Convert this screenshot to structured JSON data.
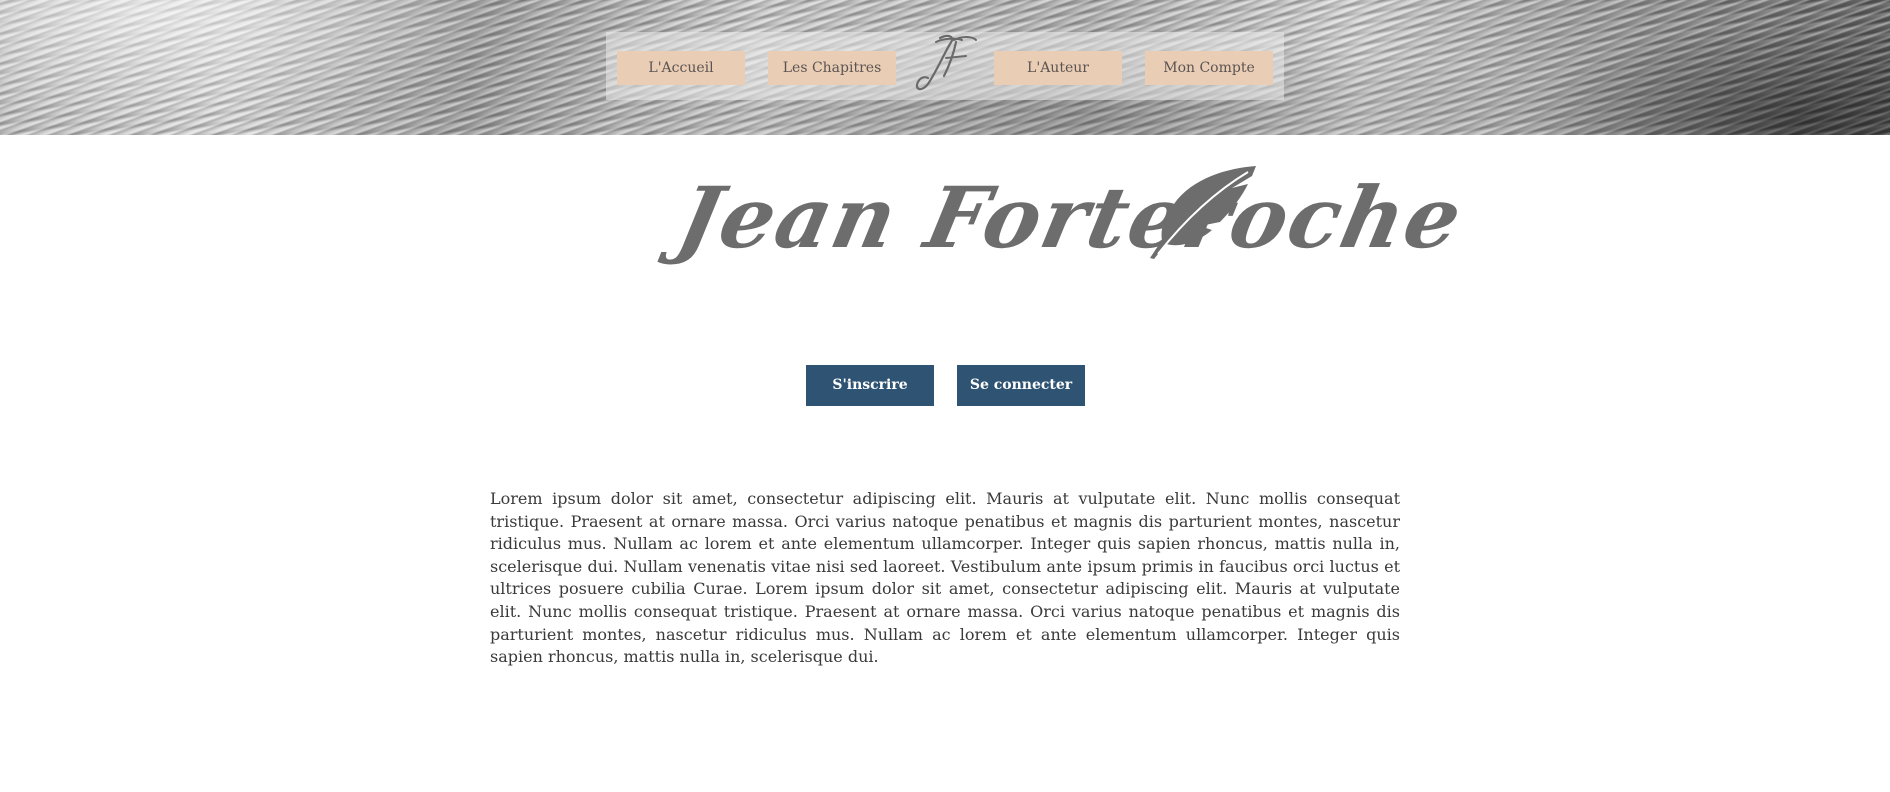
{
  "header": {
    "nav": [
      {
        "label": "L'Accueil"
      },
      {
        "label": "Les Chapitres"
      },
      {
        "label": "L'Auteur"
      },
      {
        "label": "Mon Compte"
      }
    ],
    "logo_monogram": "JF"
  },
  "main": {
    "title": "Jean Forteroche",
    "title_icon": "feather-icon",
    "buttons": {
      "signup": "S'inscrire",
      "login": "Se connecter"
    },
    "intro_text": "Lorem ipsum dolor sit amet, consectetur adipiscing elit. Mauris at vulputate elit. Nunc mollis consequat tristique. Praesent at ornare massa. Orci varius natoque penatibus et magnis dis parturient montes, nascetur ridiculus mus. Nullam ac lorem et ante elementum ullamcorper. Integer quis sapien rhoncus, mattis nulla in, scelerisque dui. Nullam venenatis vitae nisi sed laoreet. Vestibulum ante ipsum primis in faucibus orci luctus et ultrices posuere cubilia Curae. Lorem ipsum dolor sit amet, consectetur adipiscing elit. Mauris at vulputate elit. Nunc mollis consequat tristique. Praesent at ornare massa. Orci varius natoque penatibus et magnis dis parturient montes, nascetur ridiculus mus. Nullam ac lorem et ante elementum ullamcorper. Integer quis sapien rhoncus, mattis nulla in, scelerisque dui."
  },
  "colors": {
    "nav_button_bg": "#e9cdb5",
    "nav_button_text": "#5c5452",
    "auth_button_bg": "#2f5373",
    "title_color": "#6d6d6d",
    "body_text": "#3a3a3a"
  }
}
